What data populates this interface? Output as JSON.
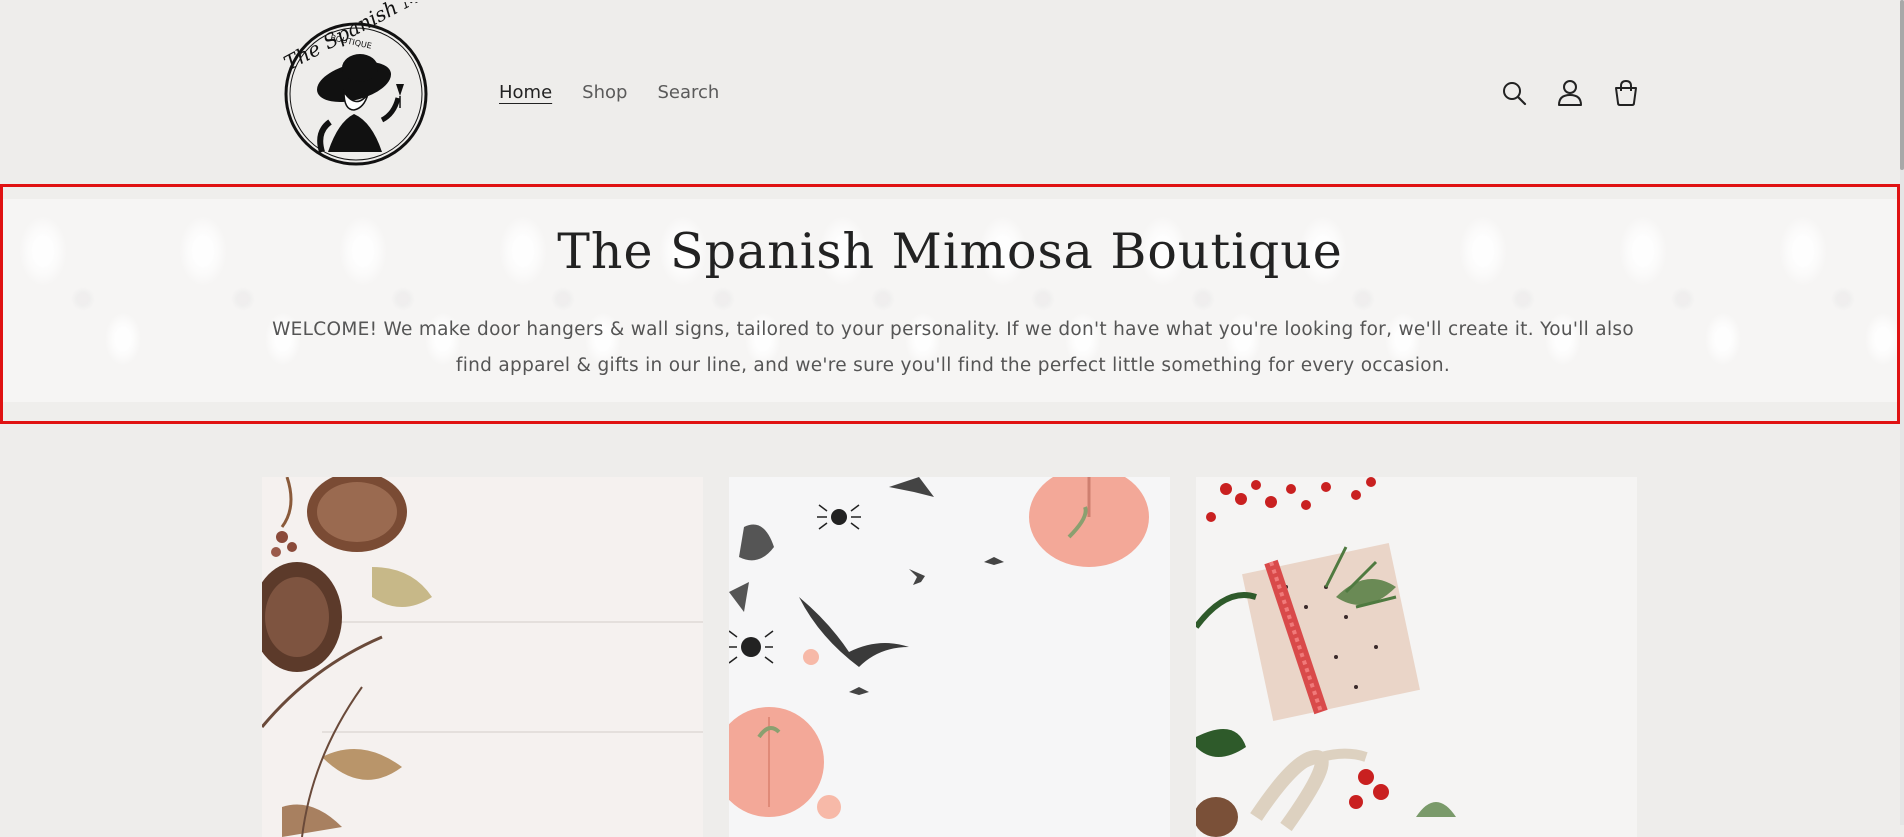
{
  "header": {
    "logo_text": "The Spanish Mimosa",
    "logo_subtext": "BOUTIQUE",
    "nav": [
      {
        "label": "Home",
        "active": true
      },
      {
        "label": "Shop",
        "active": false
      },
      {
        "label": "Search",
        "active": false
      }
    ],
    "icons": [
      "search-icon",
      "account-icon",
      "cart-icon"
    ]
  },
  "banner": {
    "title": "The Spanish Mimosa Boutique",
    "text": "WELCOME! We make door hangers & wall signs, tailored to your personality. If we don't have what you're looking for, we'll create it. You'll also find apparel & gifts in our line, and we're sure you'll find the perfect little something for every occasion."
  },
  "cards": [
    {
      "theme": "autumn-pinecones"
    },
    {
      "theme": "halloween-bats-pumpkins"
    },
    {
      "theme": "christmas-gift-berries"
    }
  ],
  "colors": {
    "background": "#eeedeb",
    "highlight_border": "#e01212"
  }
}
